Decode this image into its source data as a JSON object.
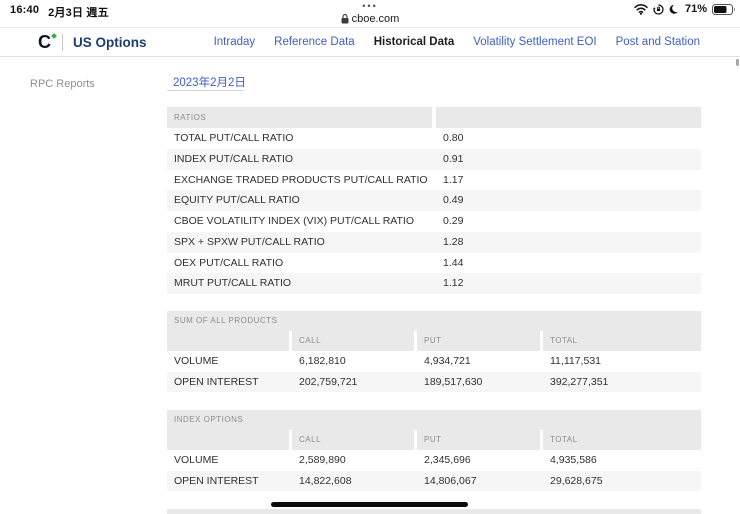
{
  "status_bar": {
    "time": "16:40",
    "date": "2月3日 週五",
    "battery": "71%"
  },
  "browser": {
    "menu_dots": "•••",
    "url": "cboe.com"
  },
  "nav": {
    "brand": "US Options",
    "links": [
      {
        "label": "Intraday",
        "active": false
      },
      {
        "label": "Reference Data",
        "active": false
      },
      {
        "label": "Historical Data",
        "active": true
      },
      {
        "label": "Volatility Settlement EOI",
        "active": false
      },
      {
        "label": "Post and Station",
        "active": false
      }
    ]
  },
  "sidebar": {
    "title": "RPC Reports"
  },
  "main": {
    "date_value": "2023年2月2日",
    "ratios_table": {
      "header": "RATIOS",
      "rows": [
        {
          "label": "TOTAL PUT/CALL RATIO",
          "value": "0.80"
        },
        {
          "label": "INDEX PUT/CALL RATIO",
          "value": "0.91"
        },
        {
          "label": "EXCHANGE TRADED PRODUCTS PUT/CALL RATIO",
          "value": "1.17"
        },
        {
          "label": "EQUITY PUT/CALL RATIO",
          "value": "0.49"
        },
        {
          "label": "CBOE VOLATILITY INDEX (VIX) PUT/CALL RATIO",
          "value": "0.29"
        },
        {
          "label": "SPX + SPXW PUT/CALL RATIO",
          "value": "1.28"
        },
        {
          "label": "OEX PUT/CALL RATIO",
          "value": "1.44"
        },
        {
          "label": "MRUT PUT/CALL RATIO",
          "value": "1.12"
        }
      ]
    },
    "sum_table": {
      "header": "SUM OF ALL PRODUCTS",
      "columns": [
        "CALL",
        "PUT",
        "TOTAL"
      ],
      "rows": [
        {
          "label": "VOLUME",
          "call": "6,182,810",
          "put": "4,934,721",
          "total": "11,117,531"
        },
        {
          "label": "OPEN INTEREST",
          "call": "202,759,721",
          "put": "189,517,630",
          "total": "392,277,351"
        }
      ]
    },
    "index_table": {
      "header": "INDEX OPTIONS",
      "columns": [
        "CALL",
        "PUT",
        "TOTAL"
      ],
      "rows": [
        {
          "label": "VOLUME",
          "call": "2,589,890",
          "put": "2,345,696",
          "total": "4,935,586"
        },
        {
          "label": "OPEN INTEREST",
          "call": "14,822,608",
          "put": "14,806,067",
          "total": "29,628,675"
        }
      ]
    }
  },
  "colors": {
    "link_blue": "#3d5fc2",
    "brand_navy": "#1f3c70",
    "logo_green": "#2eb135",
    "table_header_bg": "#e9e9e9",
    "row_stripe": "#f6f6f6"
  }
}
